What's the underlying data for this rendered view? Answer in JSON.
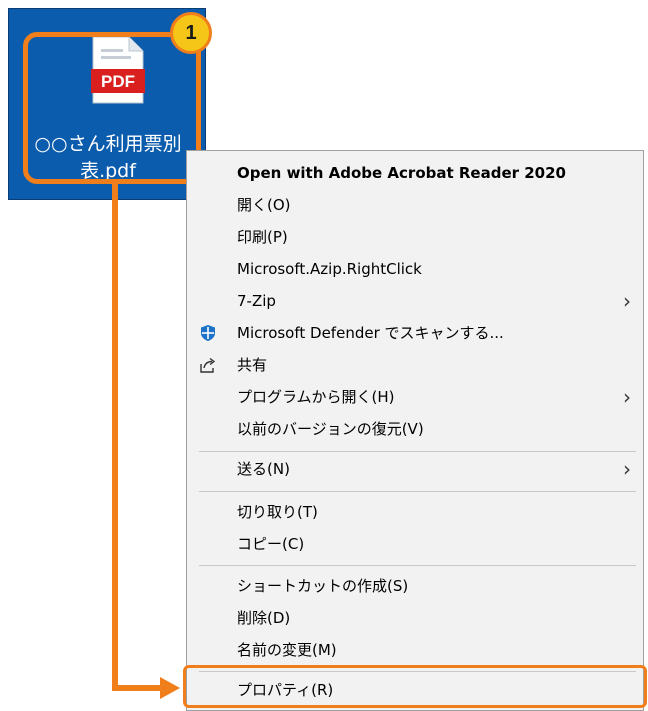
{
  "file": {
    "badge": "PDF",
    "name_line1": "○○さん利用票別",
    "name_line2": "表.pdf"
  },
  "step_number": "1",
  "menu": {
    "items": [
      {
        "label": "Open with Adobe Acrobat Reader 2020"
      },
      {
        "label": "開く(O)"
      },
      {
        "label": "印刷(P)"
      },
      {
        "label": "Microsoft.Azip.RightClick"
      },
      {
        "label": "7-Zip"
      },
      {
        "label": "Microsoft Defender でスキャンする..."
      },
      {
        "label": "共有"
      },
      {
        "label": "プログラムから開く(H)"
      },
      {
        "label": "以前のバージョンの復元(V)"
      },
      {
        "label": "送る(N)"
      },
      {
        "label": "切り取り(T)"
      },
      {
        "label": "コピー(C)"
      },
      {
        "label": "ショートカットの作成(S)"
      },
      {
        "label": "削除(D)"
      },
      {
        "label": "名前の変更(M)"
      },
      {
        "label": "プロパティ(R)"
      }
    ],
    "submenu_glyph": "›"
  },
  "colors": {
    "highlight": "#f07e1a",
    "badge_fill": "#f5c518",
    "tile_bg": "#0b5cad",
    "pdf_red": "#d9201e"
  },
  "icons": {
    "defender": "shield-icon",
    "share": "share-icon",
    "submenu": "chevron-right-icon"
  }
}
